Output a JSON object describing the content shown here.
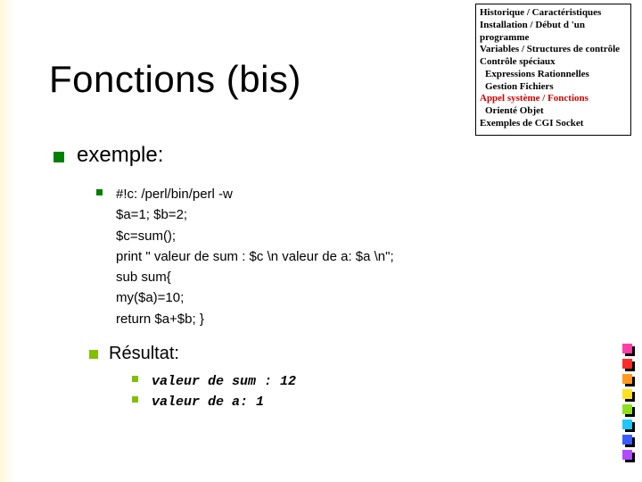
{
  "title": "Fonctions (bis)",
  "menu": {
    "l1": "Historique / Caractéristiques",
    "l2": "Installation / Début d 'un programme",
    "l3": "Variables / Structures de contrôle",
    "l4": "Contrôle spéciaux",
    "l5": "Expressions Rationnelles",
    "l6": "Gestion Fichiers",
    "l7": "Appel système / Fonctions",
    "l8": "Orienté Objet",
    "l9": "Exemples de CGI Socket"
  },
  "section1": "exemple:",
  "code": {
    "l1": "#!c: /perl/bin/perl -w",
    "l2": "$a=1; $b=2;",
    "l3": "$c=sum();",
    "l4": "print  \" valeur de sum : $c \\n valeur de a: $a \\n\";",
    "l5": "sub sum{",
    "l6": "my($a)=10;",
    "l7": "return $a+$b; }"
  },
  "section2": "Résultat:",
  "output": {
    "l1": "valeur de sum : 12",
    "l2": "valeur de a: 1"
  }
}
